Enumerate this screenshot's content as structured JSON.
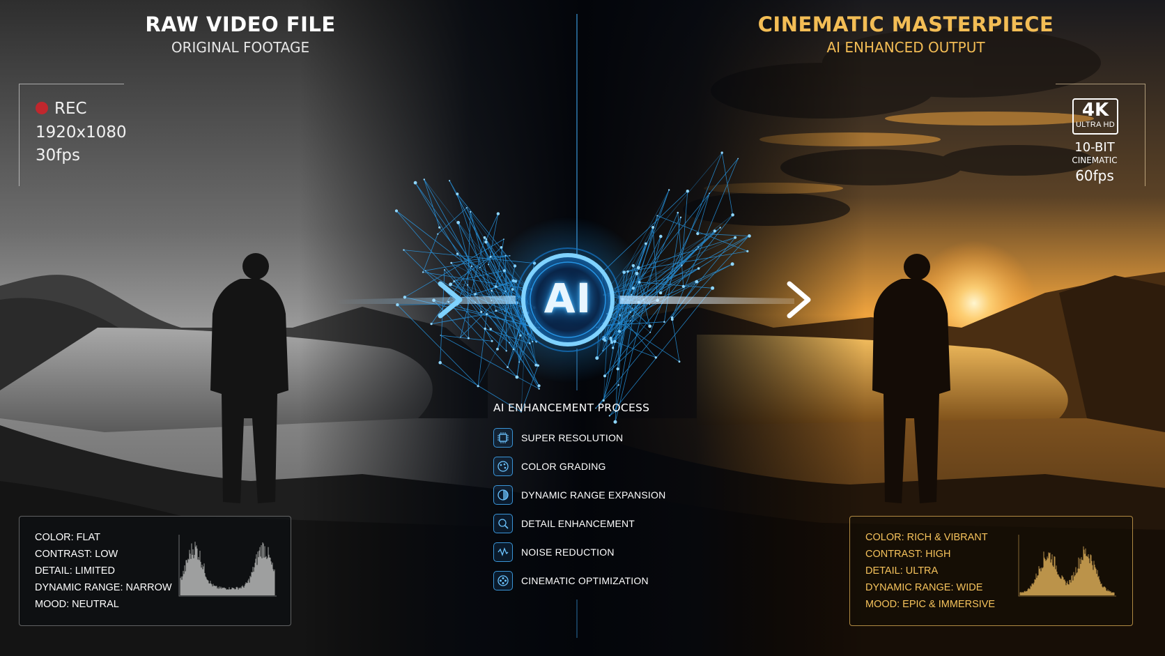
{
  "left_panel": {
    "title": "RAW VIDEO FILE",
    "subtitle": "ORIGINAL FOOTAGE",
    "rec_label": "REC",
    "resolution": "1920x1080",
    "framerate": "30fps",
    "stats": [
      "COLOR: FLAT",
      "CONTRAST: LOW",
      "DETAIL: LIMITED",
      "DYNAMIC RANGE: NARROW",
      "MOOD: NEUTRAL"
    ]
  },
  "right_panel": {
    "title": "CINEMATIC MASTERPIECE",
    "subtitle": "AI ENHANCED OUTPUT",
    "badge_main": "4K",
    "badge_sub": "ULTRA HD",
    "bit_depth": "10-BIT",
    "profile": "CINEMATIC",
    "framerate": "60fps",
    "stats": [
      "COLOR: RICH & VIBRANT",
      "CONTRAST: HIGH",
      "DETAIL: ULTRA",
      "DYNAMIC RANGE: WIDE",
      "MOOD: EPIC & IMMERSIVE"
    ]
  },
  "center": {
    "core_label": "AI",
    "process_title": "AI ENHANCEMENT PROCESS",
    "steps": [
      {
        "label": "SUPER RESOLUTION",
        "icon": "chip-icon"
      },
      {
        "label": "COLOR GRADING",
        "icon": "palette-icon"
      },
      {
        "label": "DYNAMIC RANGE EXPANSION",
        "icon": "range-icon"
      },
      {
        "label": "DETAIL ENHANCEMENT",
        "icon": "detail-icon"
      },
      {
        "label": "NOISE REDUCTION",
        "icon": "noise-icon"
      },
      {
        "label": "CINEMATIC OPTIMIZATION",
        "icon": "film-icon"
      }
    ]
  },
  "colors": {
    "accent_blue": "#2aa8ff",
    "accent_gold": "#f3bd55",
    "rec_red": "#c0272d"
  }
}
